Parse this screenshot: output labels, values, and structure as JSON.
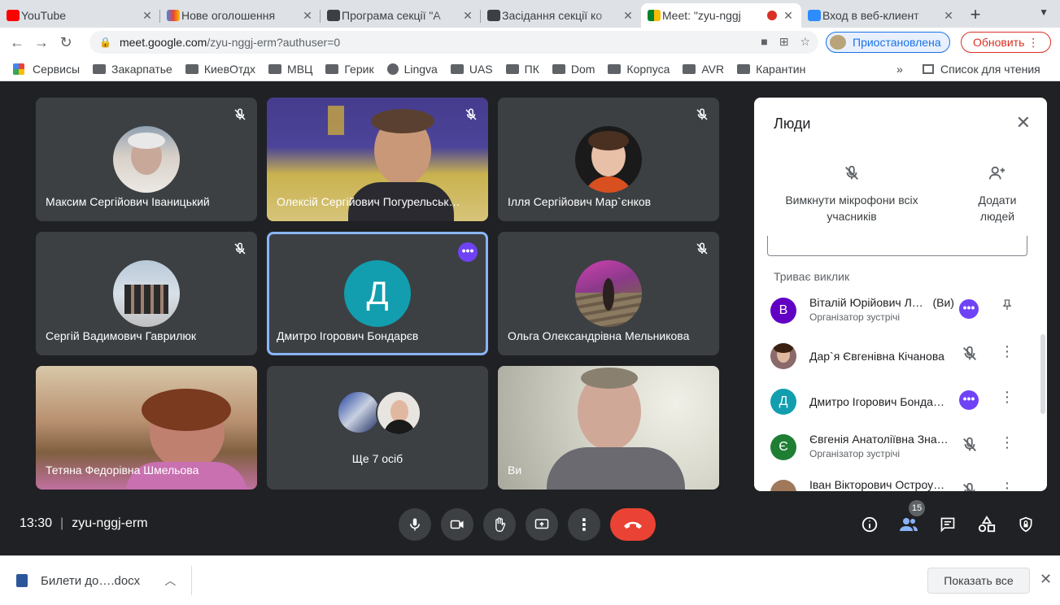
{
  "tabs": [
    {
      "title": "YouTube",
      "color": "#ff0000"
    },
    {
      "title": "Нове оголошення",
      "color": "#ea4335"
    },
    {
      "title": "Програма секції \"А",
      "color": "#3c4043"
    },
    {
      "title": "Засідання секції ко",
      "color": "#3c4043"
    },
    {
      "title": "Meet: \"zyu-nggj",
      "color": "#00832d",
      "active": true
    },
    {
      "title": "Вход в веб-клиент",
      "color": "#2d8cff"
    }
  ],
  "address": {
    "host": "meet.google.com",
    "path": "/zyu-nggj-erm?authuser=0",
    "profile": "Приостановлена",
    "update": "Обновить"
  },
  "bookmarks": [
    "Сервисы",
    "Закарпатье",
    "КиевОтдх",
    "МВЦ",
    "Герик",
    "Lingva",
    "UAS",
    "ПК",
    "Dom",
    "Корпуса",
    "AVR",
    "Карантин"
  ],
  "reading_list": "Список для чтения",
  "tiles": [
    {
      "name": "Максим Сергійович Іваницький"
    },
    {
      "name": "Олексій Сергійович Погурельськ…"
    },
    {
      "name": "Ілля Сергійович Мар`єнков"
    },
    {
      "name": "Сергій Вадимович Гаврилюк"
    },
    {
      "name": "Дмитро Ігорович Бондарєв",
      "initial": "Д"
    },
    {
      "name": "Ольга Олександрівна Мельникова"
    },
    {
      "name": "Тетяна Федорівна Шмельова"
    },
    {
      "name": "Ще 7 осіб"
    },
    {
      "name": "Ви"
    }
  ],
  "panel": {
    "title": "Люди",
    "mute_all": "Вимкнути мікрофони всіх учасників",
    "add_people": "Додати людей",
    "section": "Триває виклик",
    "people": [
      {
        "name": "Віталій Юрійович Л…",
        "you": "(Ви)",
        "role": "Організатор зустрічі",
        "initial": "В",
        "color": "#6200c4"
      },
      {
        "name": "Дар`я Євгенівна Кічанова",
        "role": "",
        "initial": "",
        "color": "#8a6a6a"
      },
      {
        "name": "Дмитро Ігорович Бонда…",
        "role": "",
        "initial": "Д",
        "color": "#129eaf"
      },
      {
        "name": "Євгенія Анатоліївна Зна…",
        "role": "Організатор зустрічі",
        "initial": "Є",
        "color": "#1e7e34"
      },
      {
        "name": "Іван Вікторович Остроу…",
        "role": "",
        "initial": "",
        "color": "#a0785a"
      }
    ]
  },
  "bottom": {
    "time": "13:30",
    "code": "zyu-nggj-erm",
    "people_count": "15"
  },
  "download": {
    "file": "Билети до….docx",
    "show_all": "Показать все"
  }
}
